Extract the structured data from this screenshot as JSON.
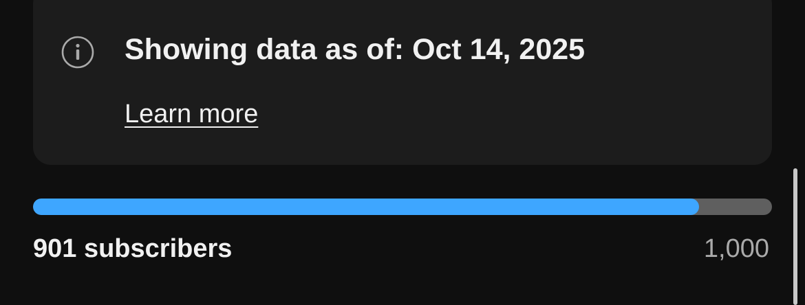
{
  "info_card": {
    "icon": "info-icon",
    "title": "Showing data as of: Oct 14, 2025",
    "link_label": "Learn more"
  },
  "progress": {
    "current_label": "901 subscribers",
    "goal_label": "1,000",
    "current": 901,
    "goal": 1000,
    "fill_color": "#3ea6ff",
    "track_color": "#5f5f5f"
  }
}
